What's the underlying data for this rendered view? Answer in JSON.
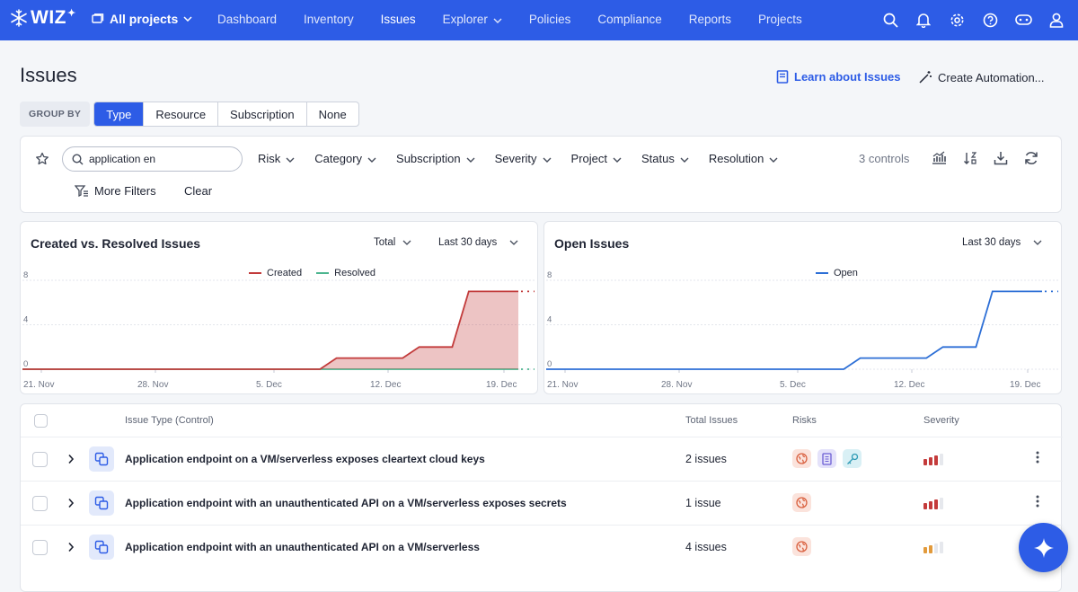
{
  "brand": {
    "name": "WIZ",
    "accent": "#2d5ce6"
  },
  "nav": {
    "project_selector": "All projects",
    "links": [
      {
        "label": "Dashboard",
        "active": false,
        "dropdown": false
      },
      {
        "label": "Inventory",
        "active": false,
        "dropdown": false
      },
      {
        "label": "Issues",
        "active": true,
        "dropdown": false
      },
      {
        "label": "Explorer",
        "active": false,
        "dropdown": true
      },
      {
        "label": "Policies",
        "active": false,
        "dropdown": false
      },
      {
        "label": "Compliance",
        "active": false,
        "dropdown": false
      },
      {
        "label": "Reports",
        "active": false,
        "dropdown": false
      },
      {
        "label": "Projects",
        "active": false,
        "dropdown": false
      }
    ],
    "icons": [
      "search-icon",
      "bell-icon",
      "gear-icon",
      "help-icon",
      "gamepad-icon",
      "user-icon"
    ]
  },
  "page": {
    "title": "Issues",
    "learn_link": "Learn about Issues",
    "automation_button": "Create Automation..."
  },
  "group_by": {
    "label": "GROUP BY",
    "options": [
      "Type",
      "Resource",
      "Subscription",
      "None"
    ],
    "selected": "Type"
  },
  "filters": {
    "search_value": "application en",
    "items": [
      "Risk",
      "Category",
      "Subscription",
      "Severity",
      "Project",
      "Status",
      "Resolution"
    ],
    "controls_count": "3 controls",
    "more_filters": "More Filters",
    "clear": "Clear"
  },
  "charts": {
    "created_resolved": {
      "title": "Created vs. Resolved Issues",
      "dropdown1": "Total",
      "dropdown2": "Last 30 days"
    },
    "open": {
      "title": "Open Issues",
      "dropdown": "Last 30 days"
    }
  },
  "chart_data": [
    {
      "type": "area",
      "yticks": [
        0,
        4,
        8
      ],
      "ylim": [
        0,
        8
      ],
      "xticks": [
        "21. Nov",
        "28. Nov",
        "5. Dec",
        "12. Dec",
        "19. Dec"
      ],
      "x": [
        0,
        18,
        19,
        23,
        24,
        26,
        27,
        30
      ],
      "series": [
        {
          "name": "Created",
          "color": "#c23b3b",
          "fill": true,
          "values": [
            0,
            0,
            1,
            1,
            2,
            2,
            7,
            7
          ]
        },
        {
          "name": "Resolved",
          "color": "#4cb58f",
          "fill": false,
          "values": [
            0,
            0,
            0,
            0,
            0,
            0,
            0,
            0
          ]
        }
      ],
      "legend": "top-center",
      "grid": true
    },
    {
      "type": "line",
      "yticks": [
        0,
        4,
        8
      ],
      "ylim": [
        0,
        8
      ],
      "xticks": [
        "21. Nov",
        "28. Nov",
        "5. Dec",
        "12. Dec",
        "19. Dec"
      ],
      "x": [
        0,
        18,
        19,
        23,
        24,
        26,
        27,
        30
      ],
      "series": [
        {
          "name": "Open",
          "color": "#2d6fd6",
          "fill": false,
          "values": [
            0,
            0,
            1,
            1,
            2,
            2,
            7,
            7
          ]
        }
      ],
      "legend": "top-center",
      "grid": true
    }
  ],
  "table": {
    "headers": {
      "type": "Issue Type (Control)",
      "total": "Total Issues",
      "risks": "Risks",
      "severity": "Severity"
    },
    "rows": [
      {
        "name": "Application endpoint on a VM/serverless exposes cleartext cloud keys",
        "count": "2 issues",
        "risks": [
          "globe-icon",
          "document-icon",
          "key-icon"
        ],
        "severity": "high"
      },
      {
        "name": "Application endpoint with an unauthenticated API on a VM/serverless exposes secrets",
        "count": "1 issue",
        "risks": [
          "globe-icon"
        ],
        "severity": "high"
      },
      {
        "name": "Application endpoint with an unauthenticated API on a VM/serverless",
        "count": "4 issues",
        "risks": [
          "globe-icon"
        ],
        "severity": "medium"
      }
    ]
  }
}
